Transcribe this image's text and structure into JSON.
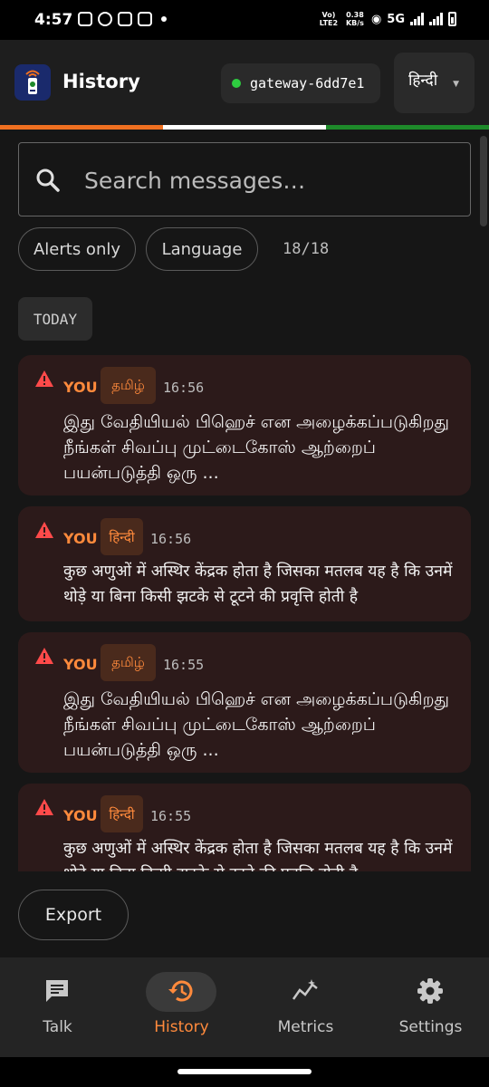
{
  "status_bar": {
    "time": "4:57",
    "volte": "Vo) LTE2",
    "speed": "0.38 KB/s",
    "network": "5G"
  },
  "header": {
    "title": "History",
    "gateway": "gateway-6dd7e1",
    "gateway_status_color": "#2ecc40",
    "language": "हिन्दी"
  },
  "flag_colors": [
    "#f07020",
    "#ffffff",
    "#1e8a2a"
  ],
  "search": {
    "placeholder": "Search messages…",
    "value": ""
  },
  "filters": {
    "alerts_label": "Alerts only",
    "language_label": "Language",
    "count": "18/18"
  },
  "section_label": "TODAY",
  "messages": [
    {
      "sender": "YOU",
      "language": "தமிழ்",
      "time": "16:56",
      "alert": true,
      "text": "இது வேதியியல் பிஹெச் என அழைக்கப்படுகிறது நீங்கள் சிவப்பு முட்டைகோஸ் ஆற்றைப் பயன்படுத்தி ஒரு ..."
    },
    {
      "sender": "YOU",
      "language": "हिन्दी",
      "time": "16:56",
      "alert": true,
      "text": "कुछ अणुओं में अस्थिर केंद्रक होता है जिसका मतलब यह है कि उनमें थोड़े या बिना किसी झटके से टूटने की प्रवृत्ति होती है"
    },
    {
      "sender": "YOU",
      "language": "தமிழ்",
      "time": "16:55",
      "alert": true,
      "text": "இது வேதியியல் பிஹெச் என அழைக்கப்படுகிறது நீங்கள் சிவப்பு முட்டைகோஸ் ஆற்றைப் பயன்படுத்தி ஒரு ..."
    },
    {
      "sender": "YOU",
      "language": "हिन्दी",
      "time": "16:55",
      "alert": true,
      "text": "कुछ अणुओं में अस्थिर केंद्रक होता है जिसका मतलब यह है कि उनमें थोड़े या बिना किसी झटके से टूटने की प्रवृत्ति होती है"
    }
  ],
  "export_label": "Export",
  "nav": {
    "active": "History",
    "items": [
      {
        "label": "Talk",
        "icon": "chat-icon"
      },
      {
        "label": "History",
        "icon": "history-icon"
      },
      {
        "label": "Metrics",
        "icon": "metrics-icon"
      },
      {
        "label": "Settings",
        "icon": "settings-gear-icon"
      }
    ]
  },
  "colors": {
    "accent": "#ff8a3c",
    "alert": "#ff4a4a",
    "card_bg": "#2c1a1a"
  }
}
